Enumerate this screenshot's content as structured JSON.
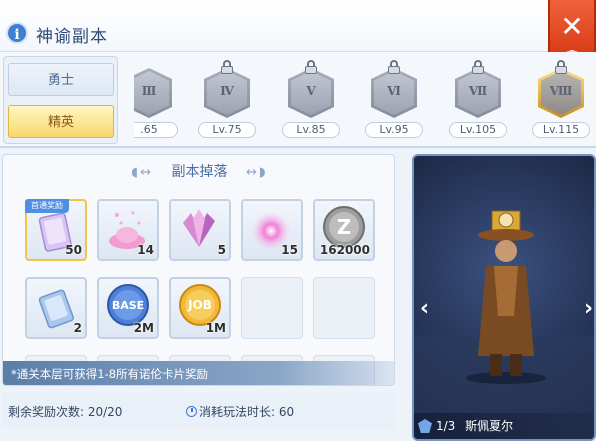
{
  "header": {
    "title": "神谕副本",
    "info_icon": "i",
    "close_icon": "✕"
  },
  "modes": {
    "normal": "勇士",
    "elite": "精英"
  },
  "levels": [
    {
      "roman": "Ⅲ",
      "level": ".65",
      "locked": false
    },
    {
      "roman": "Ⅳ",
      "level": "Lv.75",
      "locked": true
    },
    {
      "roman": "Ⅴ",
      "level": "Lv.85",
      "locked": true
    },
    {
      "roman": "Ⅵ",
      "level": "Lv.95",
      "locked": true
    },
    {
      "roman": "Ⅶ",
      "level": "Lv.105",
      "locked": true
    },
    {
      "roman": "Ⅷ",
      "level": "Lv.115",
      "locked": true
    }
  ],
  "drops": {
    "title": "副本掉落",
    "deco_left": "◖↔",
    "deco_right": "↔◗",
    "first_badge": "首通奖励",
    "items": [
      {
        "icon": "card-icon",
        "qty": "50"
      },
      {
        "icon": "pink-powder-icon",
        "qty": "14"
      },
      {
        "icon": "crystal-icon",
        "qty": "5"
      },
      {
        "icon": "pink-orb-icon",
        "qty": "15"
      },
      {
        "icon": "zeny-coin-icon",
        "qty": "162000"
      },
      {
        "icon": "blue-card-icon",
        "qty": "2"
      },
      {
        "icon": "base-exp-icon",
        "qty": "2M"
      },
      {
        "icon": "job-exp-icon",
        "qty": "1M"
      }
    ],
    "note": "*通关本层可获得1-8所有诺伦卡片奖励"
  },
  "footer": {
    "remaining": "剩余奖励次数: 20/20",
    "cost": "消耗玩法时长: 60"
  },
  "hero": {
    "index": "1/3",
    "name": "斯佩夏尔"
  },
  "colors": {
    "accent": "#3f7fd1",
    "elite": "#f8d76a",
    "close": "#d73a17"
  }
}
